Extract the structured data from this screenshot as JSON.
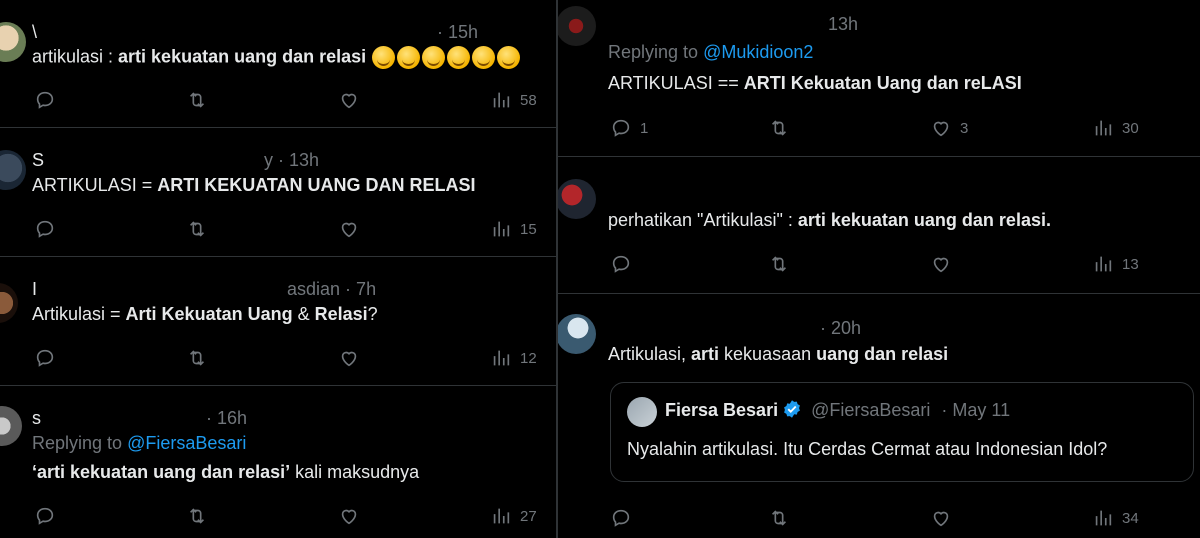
{
  "left": {
    "tweets": [
      {
        "time": "· 15h",
        "name_fragment": "\\",
        "text_plain": "artikulasi : ",
        "text_bold": "arti kekuatan uang dan relasi",
        "replies": "",
        "retweets": "",
        "likes": "",
        "views": "58"
      },
      {
        "time": "y · 13h",
        "name_fragment": "S",
        "text_plain": "ARTIKULASI = ",
        "text_bold": "ARTI KEKUATAN UANG DAN RELASI",
        "views": "15"
      },
      {
        "time": "asdian · 7h",
        "name_fragment": "I",
        "text_plain": "Artikulasi = ",
        "text_bold_1": "Arti Kekuatan Uang",
        "text_mid": " & ",
        "text_bold_2": "Relasi",
        "text_end": "?",
        "views": "12"
      },
      {
        "time": "· 16h",
        "name_fragment": "s",
        "replying_prefix": "Replying to ",
        "replying_handle": "@FiersaBesari",
        "text_quote_open": "‘",
        "text_bold": "arti kekuatan uang dan relasi",
        "text_quote_close": "’",
        "text_plain": " kali maksudnya",
        "views": "27"
      }
    ]
  },
  "right": {
    "tweets": [
      {
        "time": "13h",
        "replying_prefix": "Replying to ",
        "replying_handle": "@Mukidioon2",
        "text_plain": "ARTIKULASI == ",
        "text_bold": "ARTI Kekuatan Uang dan reLASI",
        "replies": "1",
        "likes": "3",
        "views": "30"
      },
      {
        "text_plain": "perhatikan \"Artikulasi\" : ",
        "text_bold": "arti kekuatan uang dan relasi",
        "text_end": ".",
        "views": "13"
      },
      {
        "time": "· 20h",
        "text_plain_1": "Artikulasi, ",
        "text_bold_1": "arti",
        "text_plain_2": " kekuasaan ",
        "text_bold_2": "uang dan relasi",
        "quote": {
          "name": "Fiersa Besari",
          "handle": "@FiersaBesari",
          "date": "· May 11",
          "text": "Nyalahin artikulasi. Itu Cerdas Cermat atau Indonesian Idol?"
        },
        "views": "34"
      }
    ]
  },
  "colors": {
    "background": "#000000",
    "text": "#e7e9ea",
    "muted": "#71767b",
    "link": "#1d9bf0",
    "divider": "#2f3336"
  },
  "icons": [
    "reply-icon",
    "retweet-icon",
    "like-icon",
    "views-icon",
    "verified-icon",
    "emoji-icon"
  ]
}
